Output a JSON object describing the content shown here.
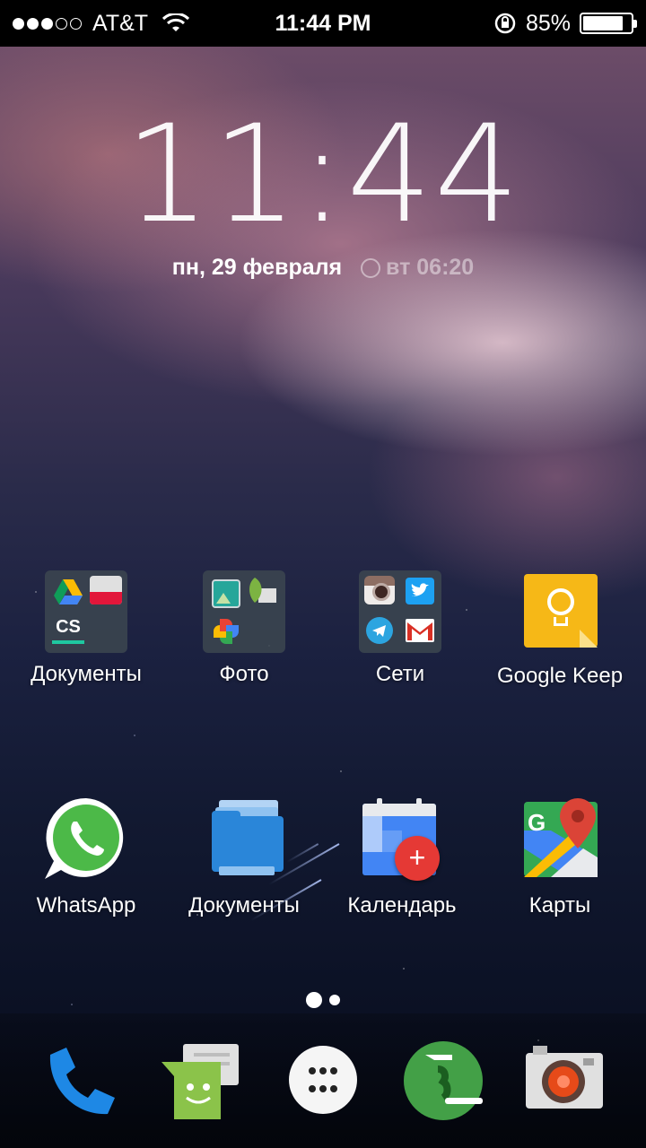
{
  "status_bar": {
    "carrier": "AT&T",
    "time": "11:44 PM",
    "battery_percent": "85%",
    "battery_level": 0.85,
    "signal_bars_filled": 3,
    "signal_bars_total": 5,
    "icons": [
      "wifi-icon",
      "rotation-lock-icon",
      "battery-icon"
    ]
  },
  "clock_widget": {
    "time": "11:44",
    "date": "пн, 29 февраля",
    "alarm": "вт 06:20"
  },
  "apps_row1": [
    {
      "label": "Документы",
      "type": "folder",
      "contents": [
        "google-drive-icon",
        "printer-icon",
        "camscanner-icon"
      ]
    },
    {
      "label": "Фото",
      "type": "folder",
      "contents": [
        "gallery-icon",
        "snapseed-icon",
        "google-photos-icon"
      ]
    },
    {
      "label": "Сети",
      "type": "folder",
      "contents": [
        "instagram-icon",
        "twitter-icon",
        "telegram-icon",
        "gmail-icon"
      ]
    },
    {
      "label": "Google Keep",
      "type": "app",
      "icon": "google-keep-icon"
    }
  ],
  "apps_row2": [
    {
      "label": "WhatsApp",
      "type": "app",
      "icon": "whatsapp-icon"
    },
    {
      "label": "Документы",
      "type": "app",
      "icon": "files-folder-icon"
    },
    {
      "label": "Календарь",
      "type": "app",
      "icon": "calendar-icon"
    },
    {
      "label": "Карты",
      "type": "app",
      "icon": "google-maps-icon"
    }
  ],
  "page_indicator": {
    "pages": 2,
    "current": 1
  },
  "dock": [
    "phone-icon",
    "messenger-icon",
    "app-drawer-icon",
    "evernote-icon",
    "camera-icon"
  ],
  "colors": {
    "keep_yellow": "#f6b817",
    "whatsapp_green": "#4cb948",
    "files_blue": "#2a86d9",
    "calendar_blue": "#4285f4",
    "calendar_red_fab": "#e53935",
    "phone_blue": "#1e88e5",
    "messenger_green": "#8bc34a"
  }
}
